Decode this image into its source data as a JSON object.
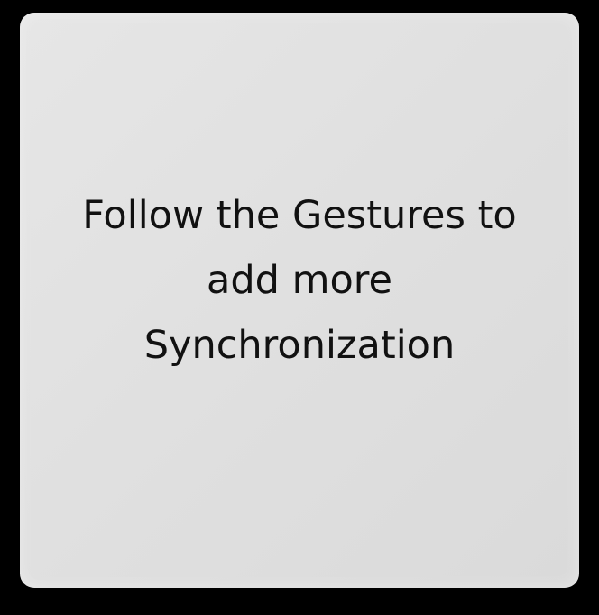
{
  "card": {
    "message": "Follow the Gestures to add more Synchronization"
  },
  "colors": {
    "background": "#000000",
    "card": "#e2e2e2",
    "text": "#111111"
  }
}
